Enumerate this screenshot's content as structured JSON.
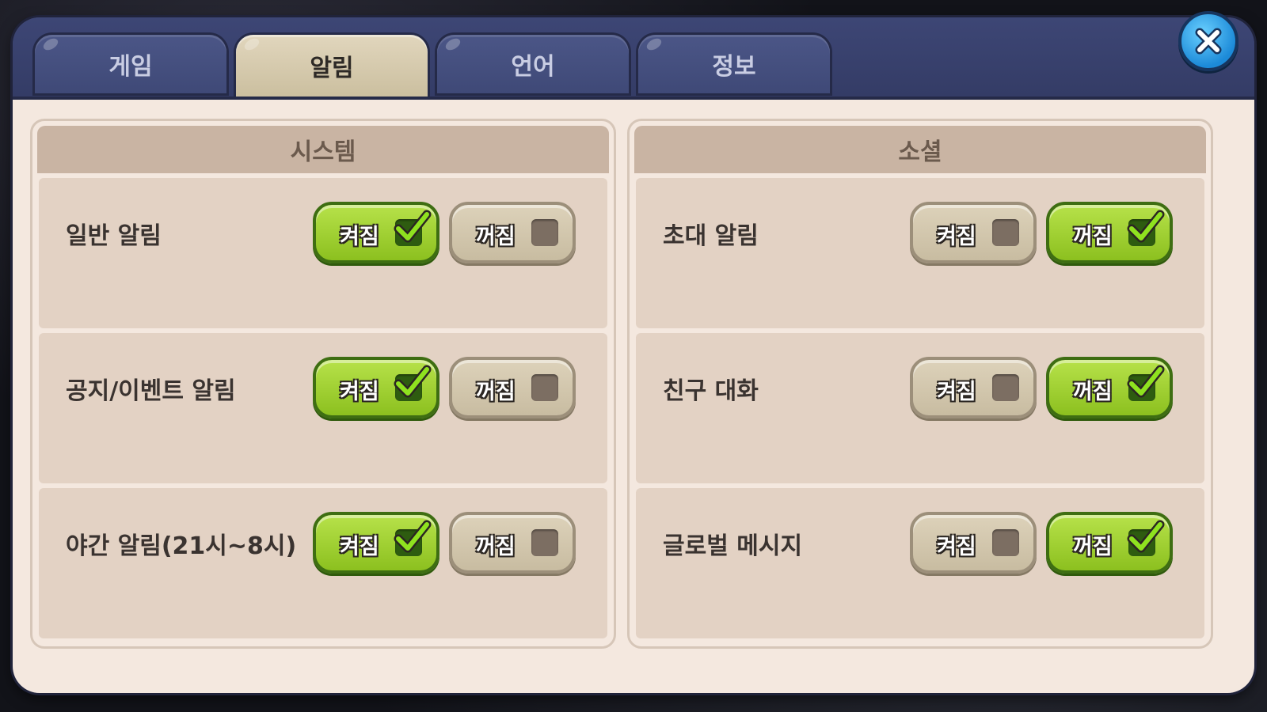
{
  "tabs": [
    {
      "label": "게임",
      "active": false
    },
    {
      "label": "알림",
      "active": true
    },
    {
      "label": "언어",
      "active": false
    },
    {
      "label": "정보",
      "active": false
    }
  ],
  "close_button": {
    "icon": "close-x-icon"
  },
  "panels": {
    "system": {
      "title": "시스템",
      "rows": [
        {
          "label": "일반 알림",
          "on_label": "켜짐",
          "off_label": "꺼짐",
          "selected": "on"
        },
        {
          "label": "공지/이벤트 알림",
          "on_label": "켜짐",
          "off_label": "꺼짐",
          "selected": "on"
        },
        {
          "label": "야간 알림(21시~8시)",
          "on_label": "켜짐",
          "off_label": "꺼짐",
          "selected": "on"
        }
      ]
    },
    "social": {
      "title": "소셜",
      "rows": [
        {
          "label": "초대 알림",
          "on_label": "켜짐",
          "off_label": "꺼짐",
          "selected": "off"
        },
        {
          "label": "친구 대화",
          "on_label": "켜짐",
          "off_label": "꺼짐",
          "selected": "off"
        },
        {
          "label": "글로벌 메시지",
          "on_label": "켜짐",
          "off_label": "꺼짐",
          "selected": "off"
        }
      ]
    }
  },
  "colors": {
    "active_toggle": "#9bd12e",
    "inactive_toggle": "#d3c8ad",
    "active_tab": "#d6cbb0",
    "tab_bar": "#3a4370",
    "close_button": "#2196e0"
  }
}
